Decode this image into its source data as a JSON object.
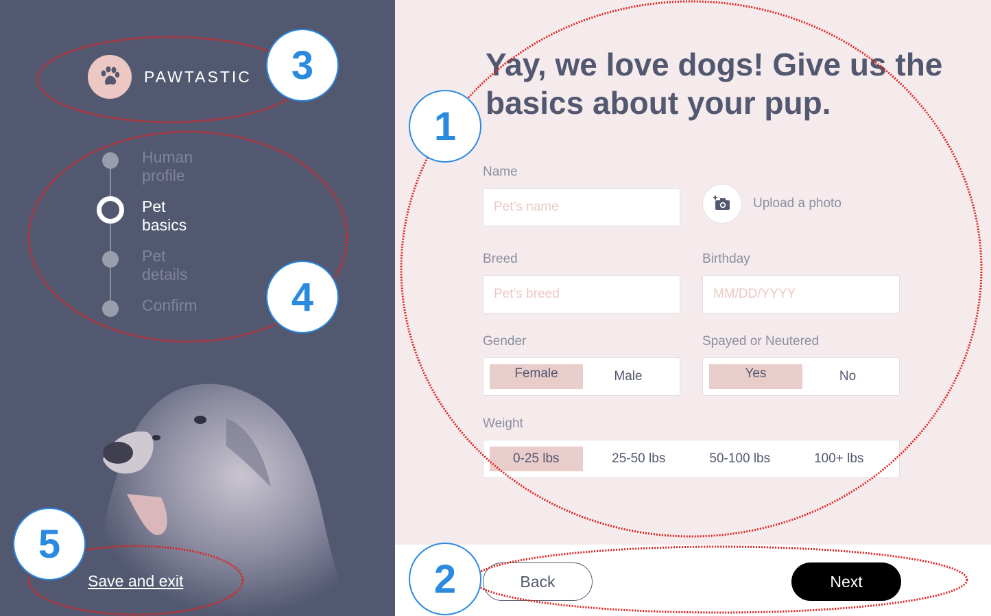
{
  "sidebar": {
    "brand": "PAWTASTIC",
    "steps": [
      {
        "label": "Human profile",
        "state": "done"
      },
      {
        "label": "Pet basics",
        "state": "active"
      },
      {
        "label": "Pet details",
        "state": "pending"
      },
      {
        "label": "Confirm",
        "state": "pending"
      }
    ],
    "save_exit": "Save and exit"
  },
  "form": {
    "headline": "Yay, we love dogs! Give us the basics about your pup.",
    "name_label": "Name",
    "name_placeholder": "Pet’s name",
    "upload_label": "Upload a photo",
    "breed_label": "Breed",
    "breed_placeholder": "Pet’s breed",
    "birthday_label": "Birthday",
    "birthday_placeholder": "MM/DD/YYYY",
    "gender_label": "Gender",
    "gender_options": [
      "Female",
      "Male"
    ],
    "gender_selected": "Female",
    "spayed_label": "Spayed or Neutered",
    "spayed_options": [
      "Yes",
      "No"
    ],
    "spayed_selected": "Yes",
    "weight_label": "Weight",
    "weight_options": [
      "0-25 lbs",
      "25-50 lbs",
      "50-100 lbs",
      "100+ lbs"
    ],
    "weight_selected": "0-25 lbs"
  },
  "footer": {
    "back_label": "Back",
    "next_label": "Next"
  },
  "annotations": {
    "badges": [
      "1",
      "2",
      "3",
      "4",
      "5"
    ]
  },
  "colors": {
    "sidebar_bg": "#525870",
    "panel_bg": "#f6ebec",
    "accent_pink": "#ecc7c3",
    "selected_pink": "#e9cdcb",
    "annotation_red": "#e0201e",
    "annotation_blue": "#2a8ae0"
  },
  "icons": {
    "logo": "paw-icon",
    "upload": "camera-add-icon"
  }
}
